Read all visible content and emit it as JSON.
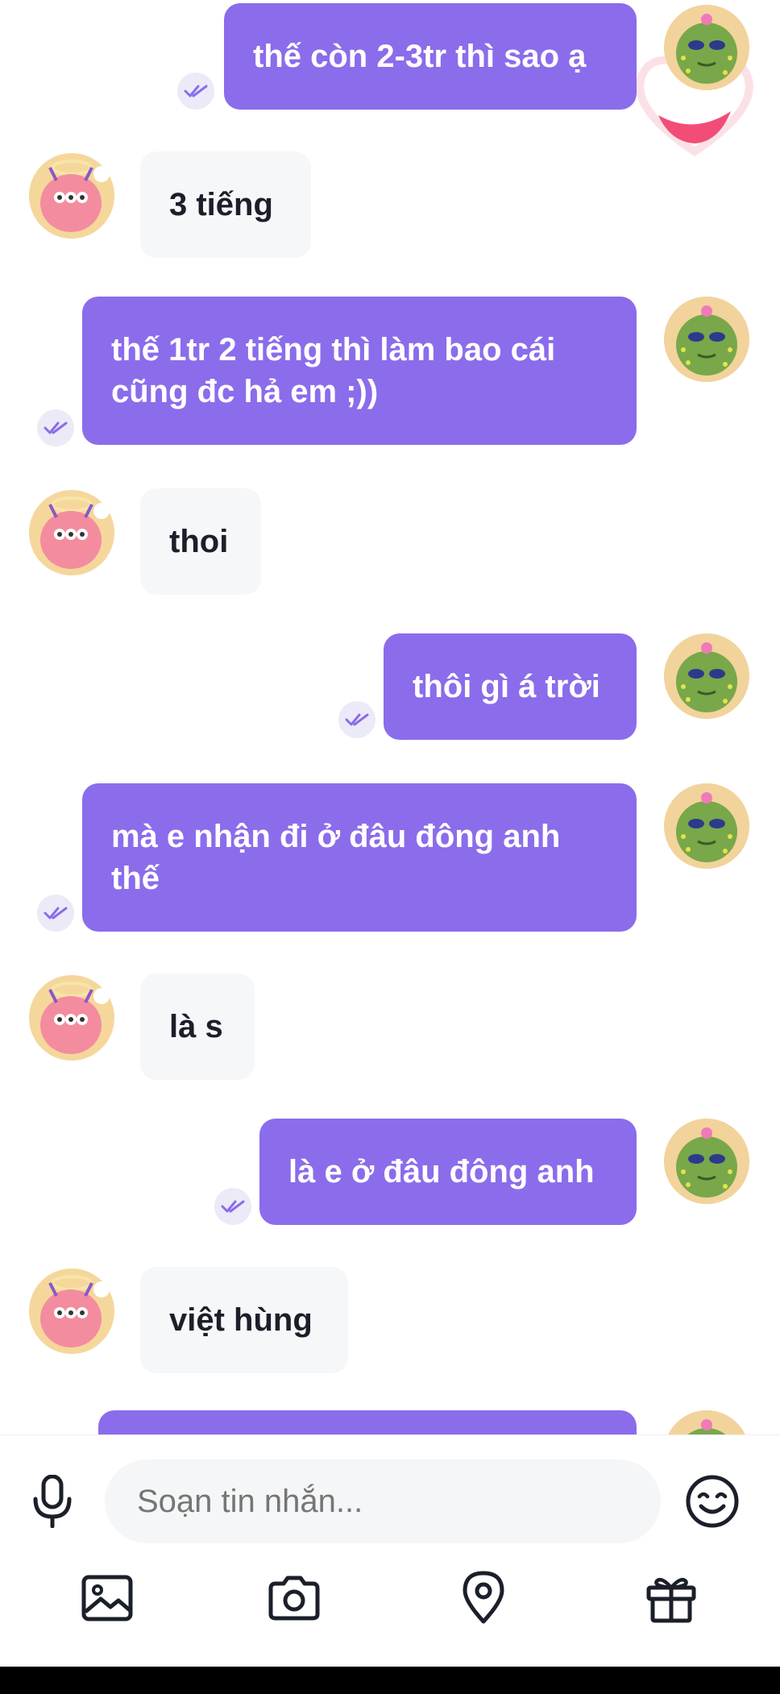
{
  "messages": [
    {
      "from": "me",
      "text": "thế còn 2-3tr thì sao ạ"
    },
    {
      "from": "them",
      "text": "3 tiếng"
    },
    {
      "from": "me",
      "lines": [
        "thế 1tr 2 tiếng thì làm bao cái",
        "cũng đc hả em ;))"
      ]
    },
    {
      "from": "them",
      "text": "thoi"
    },
    {
      "from": "me",
      "text": "thôi gì á trời"
    },
    {
      "from": "me",
      "lines": [
        "mà e nhận đi ở đâu đông anh",
        "thế"
      ]
    },
    {
      "from": "them",
      "text": "là s"
    },
    {
      "from": "me",
      "text": "là e ở đâu đông anh"
    },
    {
      "from": "them",
      "text": "việt hùng"
    }
  ],
  "composer": {
    "placeholder": "Soạn tin nhắn..."
  },
  "toolbar": {
    "icons": [
      "image-icon",
      "camera-icon",
      "location-icon",
      "gift-icon"
    ]
  },
  "colors": {
    "accent": "#8b6ceb",
    "incoming_bubble": "#f6f7f8",
    "incoming_text": "#1b1f2a",
    "tick": "#8b6ceb"
  }
}
